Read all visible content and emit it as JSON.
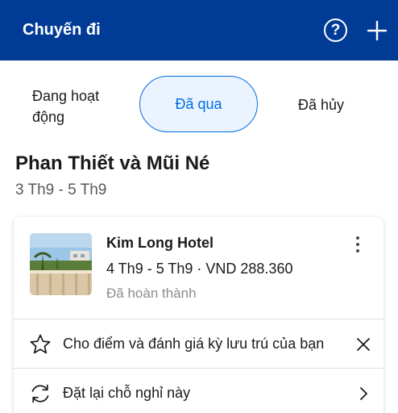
{
  "header": {
    "title": "Chuyến đi",
    "help_icon": "?",
    "icons": [
      "help-circle-icon",
      "plus-icon"
    ]
  },
  "tabs": [
    {
      "label_line1": "Đang hoạt",
      "label_line2": "động",
      "active": false
    },
    {
      "label": "Đã qua",
      "active": true
    },
    {
      "label": "Đã hủy",
      "active": false
    }
  ],
  "trip": {
    "title": "Phan Thiết và Mũi Né",
    "dates": "3 Th9 - 5 Th9"
  },
  "booking": {
    "hotel_name": "Kim Long Hotel",
    "dates_price": "4 Th9 - 5 Th9 · VND 288.360",
    "status": "Đã hoàn thành"
  },
  "actions": [
    {
      "label": "Cho điểm và đánh giá kỳ lưu trú của bạn",
      "icon": "star-outline-icon",
      "action_icon": "close-icon"
    },
    {
      "label": "Đặt lại chỗ nghỉ này",
      "icon": "rebook-icon",
      "action_icon": "chevron-right-icon"
    }
  ],
  "colors": {
    "brand": "#003b95",
    "accent": "#006ce4",
    "active_tab_bg": "#ebf3ff",
    "muted_text": "#8c8c8c"
  }
}
